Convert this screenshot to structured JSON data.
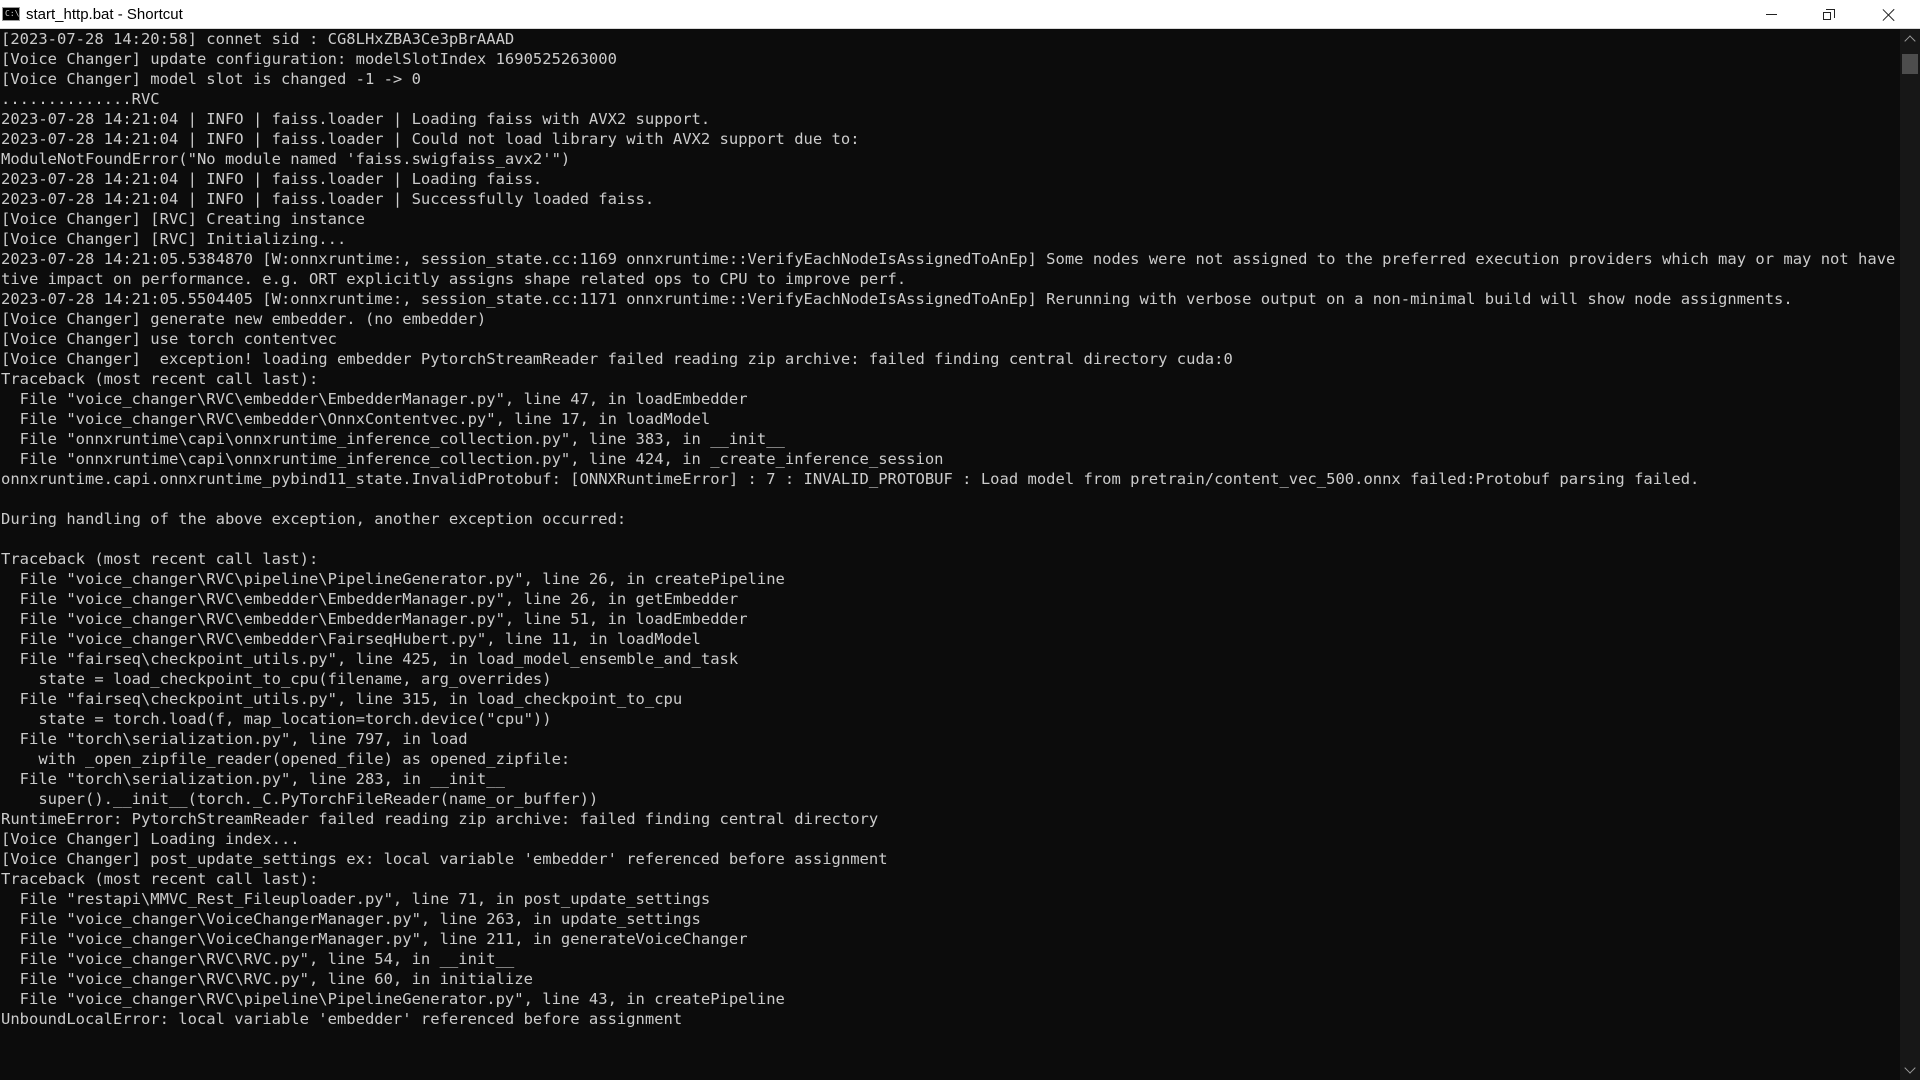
{
  "window": {
    "title": "start_http.bat - Shortcut",
    "icon": "cmd-icon"
  },
  "controls": {
    "minimize": "minimize-icon",
    "maximize": "restore-icon",
    "close": "close-icon"
  },
  "console": {
    "lines": [
      "[2023-07-28 14:20:58] connet sid : CG8LHxZBA3Ce3pBrAAAD",
      "[Voice Changer] update configuration: modelSlotIndex 1690525263000",
      "[Voice Changer] model slot is changed -1 -> 0",
      "..............RVC",
      "2023-07-28 14:21:04 | INFO | faiss.loader | Loading faiss with AVX2 support.",
      "2023-07-28 14:21:04 | INFO | faiss.loader | Could not load library with AVX2 support due to:",
      "ModuleNotFoundError(\"No module named 'faiss.swigfaiss_avx2'\")",
      "2023-07-28 14:21:04 | INFO | faiss.loader | Loading faiss.",
      "2023-07-28 14:21:04 | INFO | faiss.loader | Successfully loaded faiss.",
      "[Voice Changer] [RVC] Creating instance",
      "[Voice Changer] [RVC] Initializing...",
      "2023-07-28 14:21:05.5384870 [W:onnxruntime:, session_state.cc:1169 onnxruntime::VerifyEachNodeIsAssignedToAnEp] Some nodes were not assigned to the preferred execution providers which may or may not have an nega",
      "tive impact on performance. e.g. ORT explicitly assigns shape related ops to CPU to improve perf.",
      "2023-07-28 14:21:05.5504405 [W:onnxruntime:, session_state.cc:1171 onnxruntime::VerifyEachNodeIsAssignedToAnEp] Rerunning with verbose output on a non-minimal build will show node assignments.",
      "[Voice Changer] generate new embedder. (no embedder)",
      "[Voice Changer] use torch contentvec",
      "[Voice Changer]  exception! loading embedder PytorchStreamReader failed reading zip archive: failed finding central directory cuda:0",
      "Traceback (most recent call last):",
      "  File \"voice_changer\\RVC\\embedder\\EmbedderManager.py\", line 47, in loadEmbedder",
      "  File \"voice_changer\\RVC\\embedder\\OnnxContentvec.py\", line 17, in loadModel",
      "  File \"onnxruntime\\capi\\onnxruntime_inference_collection.py\", line 383, in __init__",
      "  File \"onnxruntime\\capi\\onnxruntime_inference_collection.py\", line 424, in _create_inference_session",
      "onnxruntime.capi.onnxruntime_pybind11_state.InvalidProtobuf: [ONNXRuntimeError] : 7 : INVALID_PROTOBUF : Load model from pretrain/content_vec_500.onnx failed:Protobuf parsing failed.",
      "",
      "During handling of the above exception, another exception occurred:",
      "",
      "Traceback (most recent call last):",
      "  File \"voice_changer\\RVC\\pipeline\\PipelineGenerator.py\", line 26, in createPipeline",
      "  File \"voice_changer\\RVC\\embedder\\EmbedderManager.py\", line 26, in getEmbedder",
      "  File \"voice_changer\\RVC\\embedder\\EmbedderManager.py\", line 51, in loadEmbedder",
      "  File \"voice_changer\\RVC\\embedder\\FairseqHubert.py\", line 11, in loadModel",
      "  File \"fairseq\\checkpoint_utils.py\", line 425, in load_model_ensemble_and_task",
      "    state = load_checkpoint_to_cpu(filename, arg_overrides)",
      "  File \"fairseq\\checkpoint_utils.py\", line 315, in load_checkpoint_to_cpu",
      "    state = torch.load(f, map_location=torch.device(\"cpu\"))",
      "  File \"torch\\serialization.py\", line 797, in load",
      "    with _open_zipfile_reader(opened_file) as opened_zipfile:",
      "  File \"torch\\serialization.py\", line 283, in __init__",
      "    super().__init__(torch._C.PyTorchFileReader(name_or_buffer))",
      "RuntimeError: PytorchStreamReader failed reading zip archive: failed finding central directory",
      "[Voice Changer] Loading index...",
      "[Voice Changer] post_update_settings ex: local variable 'embedder' referenced before assignment",
      "Traceback (most recent call last):",
      "  File \"restapi\\MMVC_Rest_Fileuploader.py\", line 71, in post_update_settings",
      "  File \"voice_changer\\VoiceChangerManager.py\", line 263, in update_settings",
      "  File \"voice_changer\\VoiceChangerManager.py\", line 211, in generateVoiceChanger",
      "  File \"voice_changer\\RVC\\RVC.py\", line 54, in __init__",
      "  File \"voice_changer\\RVC\\RVC.py\", line 60, in initialize",
      "  File \"voice_changer\\RVC\\pipeline\\PipelineGenerator.py\", line 43, in createPipeline",
      "UnboundLocalError: local variable 'embedder' referenced before assignment"
    ]
  },
  "scrollbar": {
    "up_icon": "chevron-up-icon",
    "down_icon": "chevron-down-icon"
  },
  "colors": {
    "console_background": "#0c0c0c",
    "console_text": "#cccccc",
    "titlebar_background": "#ffffff"
  }
}
